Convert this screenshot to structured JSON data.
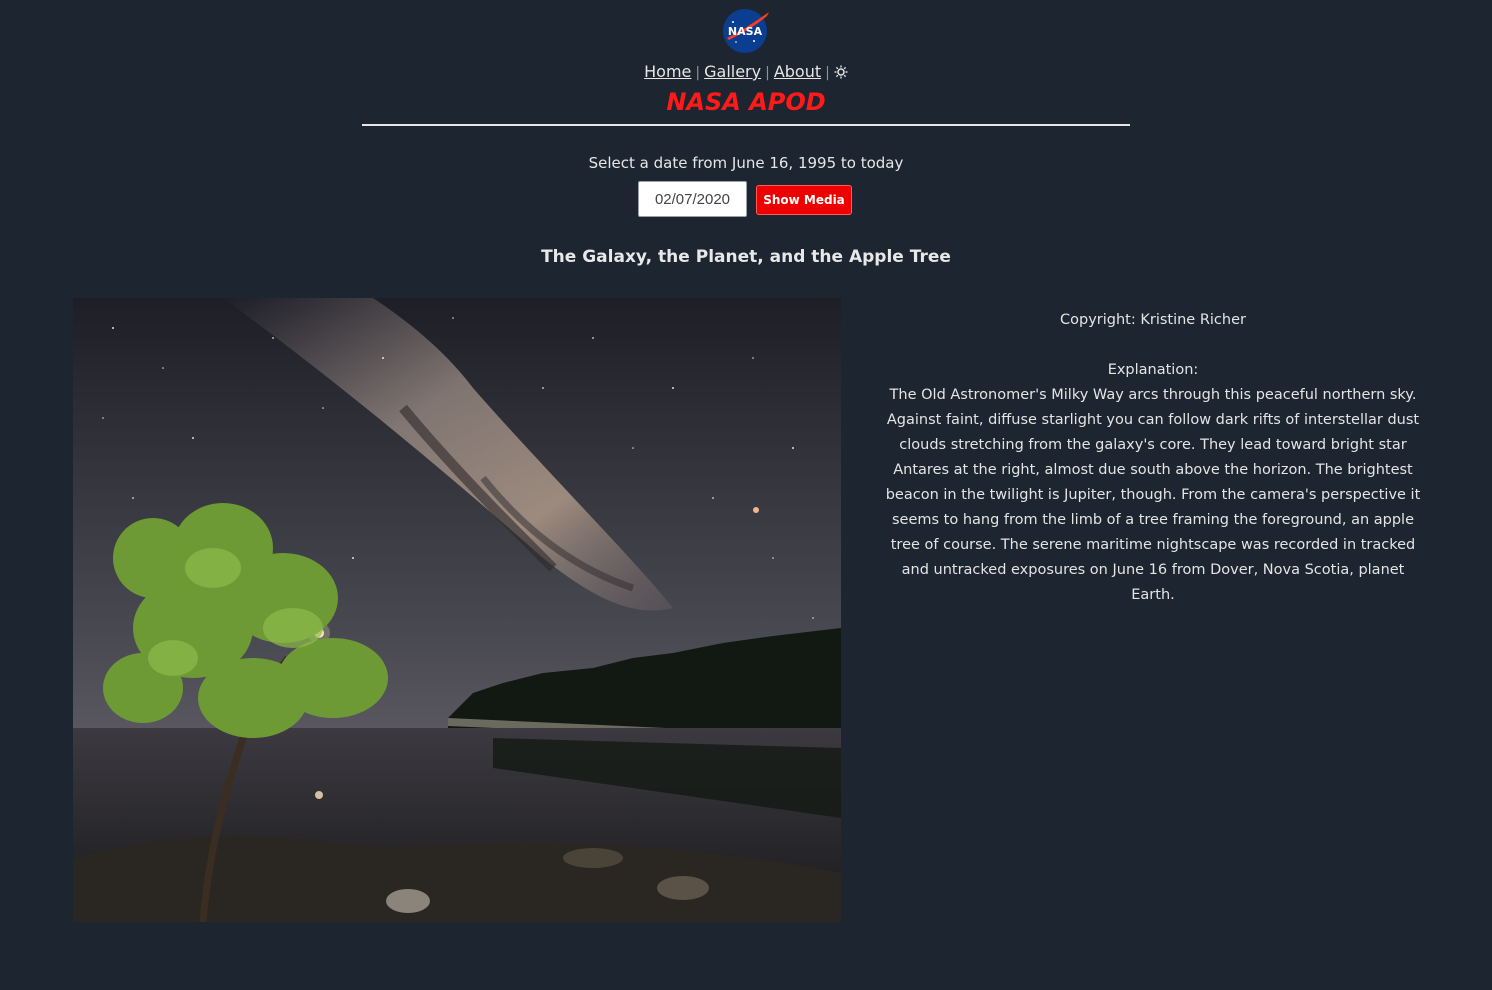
{
  "header": {
    "logo_icon": "nasa-meatball-logo",
    "logo_text": "NASA",
    "nav": [
      {
        "label": "Home"
      },
      {
        "label": "Gallery"
      },
      {
        "label": "About"
      }
    ],
    "theme_toggle_icon": "sun-icon",
    "brand": "NASA APOD",
    "brand_color": "#ff1a1a"
  },
  "date_picker": {
    "prompt": "Select a date from June 16, 1995 to today",
    "value": "02/07/2020",
    "button_label": "Show Media",
    "button_color": "#ee0000"
  },
  "media": {
    "title": "The Galaxy, the Planet, and the Apple Tree",
    "copyright": "Copyright: Kristine Richer",
    "explanation_label": "Explanation:",
    "explanation": "The Old Astronomer's Milky Way arcs through this peaceful northern sky. Against faint, diffuse starlight you can follow dark rifts of interstellar dust clouds stretching from the galaxy's core. They lead toward bright star Antares at the right, almost due south above the horizon. The brightest beacon in the twilight is Jupiter, though. From the camera's perspective it seems to hang from the limb of a tree framing the foreground, an apple tree of course. The serene maritime nightscape was recorded in tracked and untracked exposures on June 16 from Dover, Nova Scotia, planet Earth."
  },
  "colors": {
    "background": "#1c2530",
    "text": "#e6e6e6"
  }
}
